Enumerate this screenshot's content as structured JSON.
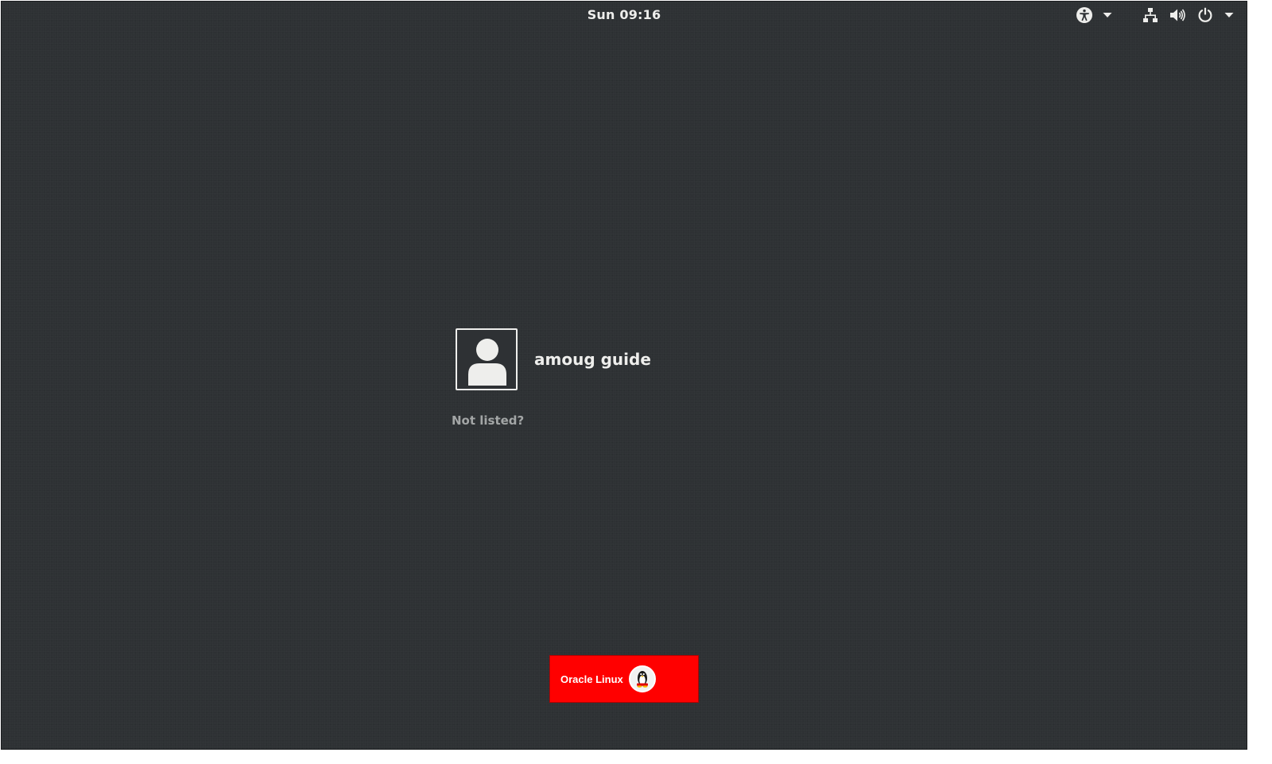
{
  "topbar": {
    "clock": "Sun 09:16",
    "icons": [
      "accessibility-icon",
      "network-wired-icon",
      "volume-icon",
      "power-icon"
    ]
  },
  "user_list": {
    "users": [
      {
        "display_name": "amoug guide",
        "avatar": "default-user-icon"
      }
    ],
    "not_listed_label": "Not listed?"
  },
  "branding": {
    "label": "Oracle Linux",
    "badge_icon": "tux-penguin-icon",
    "background_color": "#ff0000"
  },
  "colors": {
    "background": "#2e3134",
    "foreground": "#eeeeec",
    "muted": "#a3a6a6"
  }
}
